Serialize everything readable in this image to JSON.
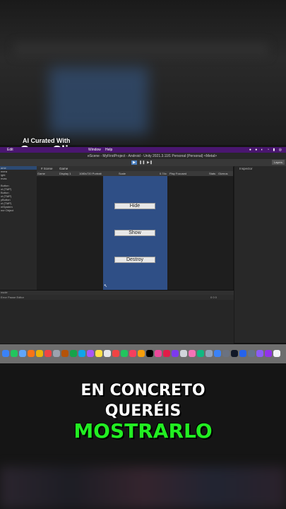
{
  "watermark": {
    "line1": "AI Curated With",
    "line2": "OpusClip"
  },
  "menubar": {
    "items": [
      "Edit",
      "Window",
      "Help"
    ]
  },
  "window": {
    "title": "eScene - MyFirstProject - Android - Unity 2021.3.11f1 Personal (Personal) <Metal>"
  },
  "toolbar": {
    "play": "▶",
    "pause": "❚❚",
    "step": "▶❚",
    "layers": "Layers"
  },
  "hierarchy": {
    "items": [
      "ame",
      "mera",
      "ight",
      "nvas",
      "",
      "Button",
      "xt (TMP)",
      "Button",
      "xt (TMP)",
      "yButton",
      "xt (TMP)",
      "ntSystem",
      "me Object"
    ]
  },
  "tabs": {
    "scene": "# Scene",
    "game": "Game"
  },
  "gamebar": {
    "display_mode": "Game",
    "display": "Display 1",
    "resolution": "1080x720 Portrait",
    "scale_label": "Scale",
    "scale_value": "0.74x",
    "play_mode": "Play Focused",
    "stats": "Stats",
    "gizmos": "Gizmos"
  },
  "game_buttons": {
    "hide": "Hide",
    "show": "Show",
    "destroy": "Destroy"
  },
  "inspector": {
    "title": "Inspector"
  },
  "console": {
    "tab": "nsole",
    "toolbar": "Error Pause  Editor",
    "counts": "0  0  0"
  },
  "dock": {
    "colors": [
      "#3b82f6",
      "#22c55e",
      "#60a5fa",
      "#f97316",
      "#eab308",
      "#ef4444",
      "#9ca3af",
      "#b45309",
      "#16a34a",
      "#0ea5e9",
      "#a855f7",
      "#fde047",
      "#e5e7eb",
      "#ef4444",
      "#22c55e",
      "#f43f5e",
      "#f59e0b",
      "#000000",
      "#ec4899",
      "#e11d48",
      "#7c3aed",
      "#d1d5db",
      "#f472b6",
      "#10b981",
      "#94a3b8",
      "#3b82f6",
      "#6b7280",
      "#111827",
      "#2563eb",
      "#64748b",
      "#8b5cf6",
      "#9333ea",
      "#f3f4f6"
    ]
  },
  "caption": {
    "line1": "EN CONCRETO",
    "line2": "QUERÉIS",
    "line3": "MOSTRARLO"
  }
}
